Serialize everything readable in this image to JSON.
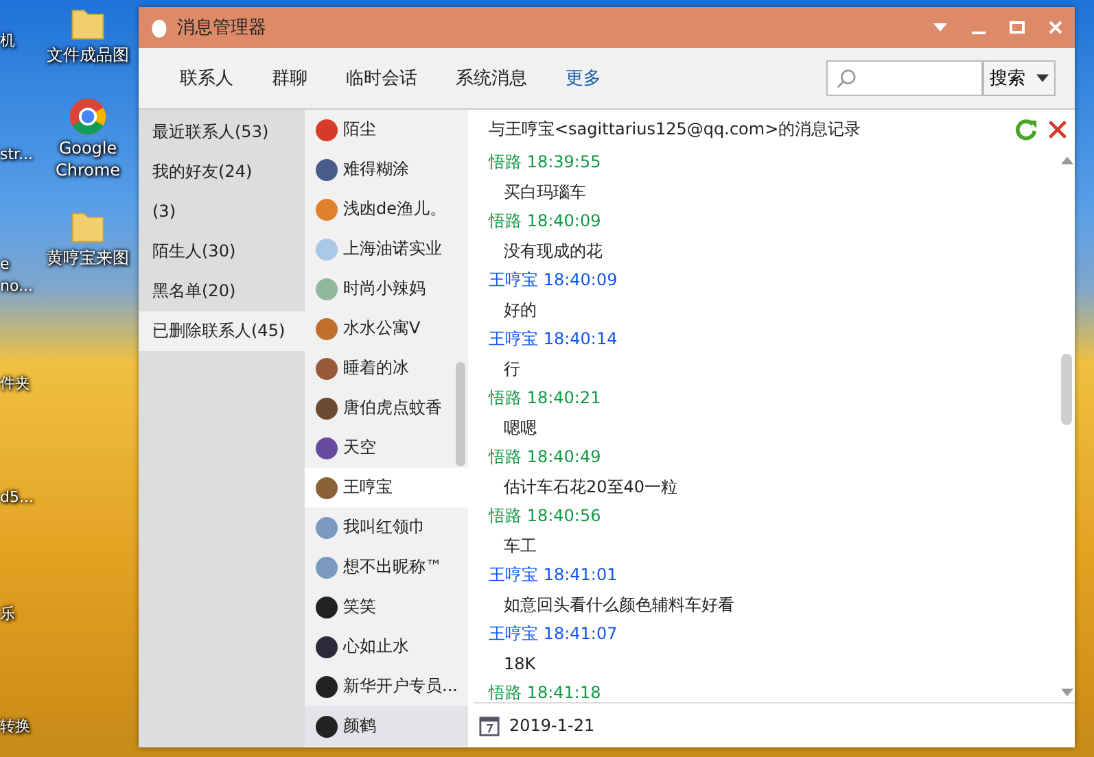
{
  "desktop": {
    "icons": [
      {
        "label": "机",
        "kind": "generic"
      },
      {
        "label": "str...",
        "kind": "generic"
      },
      {
        "label": "e\nno...",
        "kind": "generic"
      },
      {
        "label": "件夹",
        "kind": "generic"
      },
      {
        "label": "d5...",
        "kind": "generic"
      },
      {
        "label": "乐",
        "kind": "generic"
      },
      {
        "label": "转换",
        "kind": "generic"
      },
      {
        "label": "文件成品图",
        "kind": "folder"
      },
      {
        "label": "Google Chrome",
        "kind": "browser"
      },
      {
        "label": "黄哼宝来图",
        "kind": "folder"
      }
    ]
  },
  "window": {
    "title": "消息管理器"
  },
  "tabs": [
    {
      "label": "联系人",
      "kind": "tab"
    },
    {
      "label": "群聊",
      "kind": "tab"
    },
    {
      "label": "临时会话",
      "kind": "tab"
    },
    {
      "label": "系统消息",
      "kind": "tab"
    },
    {
      "label": "更多",
      "kind": "link"
    }
  ],
  "search": {
    "button": "搜索"
  },
  "sidebar": {
    "items": [
      {
        "label": "最近联系人(53)",
        "selected": false
      },
      {
        "label": "我的好友(24)",
        "selected": false
      },
      {
        "label": "(3)",
        "selected": false
      },
      {
        "label": "陌生人(30)",
        "selected": false
      },
      {
        "label": "黑名单(20)",
        "selected": false
      },
      {
        "label": "已删除联系人(45)",
        "selected": true
      }
    ]
  },
  "contacts": [
    {
      "name": "陌尘",
      "selected": false,
      "hovered": false,
      "color": "#d83a2a"
    },
    {
      "name": "难得糊涂",
      "selected": false,
      "hovered": false,
      "color": "#4a5c8a"
    },
    {
      "name": "浅凼de渔儿。",
      "selected": false,
      "hovered": false,
      "color": "#e0822c"
    },
    {
      "name": "上海油诺实业",
      "selected": false,
      "hovered": false,
      "color": "#a9c8e8"
    },
    {
      "name": "时尚小辣妈",
      "selected": false,
      "hovered": false,
      "color": "#8fb89a"
    },
    {
      "name": "水水公寓V",
      "selected": false,
      "hovered": false,
      "color": "#c0702a"
    },
    {
      "name": "睡着的冰",
      "selected": false,
      "hovered": false,
      "color": "#9a5a3a"
    },
    {
      "name": "唐伯虎点蚊香",
      "selected": false,
      "hovered": false,
      "color": "#6a4a30"
    },
    {
      "name": "天空",
      "selected": false,
      "hovered": false,
      "color": "#6a4aa0"
    },
    {
      "name": "王哼宝",
      "selected": true,
      "hovered": false,
      "color": "#8a6238"
    },
    {
      "name": "我叫红领巾",
      "selected": false,
      "hovered": false,
      "color": "#7a9ac0"
    },
    {
      "name": "想不出昵称™",
      "selected": false,
      "hovered": false,
      "color": "#7a9ac0"
    },
    {
      "name": "笑笑",
      "selected": false,
      "hovered": false,
      "color": "#222222"
    },
    {
      "name": "心如止水",
      "selected": false,
      "hovered": false,
      "color": "#2a2a3a"
    },
    {
      "name": "新华开户专员...",
      "selected": false,
      "hovered": false,
      "color": "#222222"
    },
    {
      "name": "颜鹤",
      "selected": false,
      "hovered": true,
      "color": "#222222"
    }
  ],
  "chat": {
    "title": "与王哼宝<sagittarius125@qq.com>的消息记录",
    "messages": [
      {
        "sender": "悟路",
        "time": "18:39:55",
        "text": "买白玛瑙车",
        "kind": "me"
      },
      {
        "sender": "悟路",
        "time": "18:40:09",
        "text": "没有现成的花",
        "kind": "me"
      },
      {
        "sender": "王哼宝",
        "time": "18:40:09",
        "text": "好的",
        "kind": "friend"
      },
      {
        "sender": "王哼宝",
        "time": "18:40:14",
        "text": "行",
        "kind": "friend"
      },
      {
        "sender": "悟路",
        "time": "18:40:21",
        "text": "嗯嗯",
        "kind": "me"
      },
      {
        "sender": "悟路",
        "time": "18:40:49",
        "text": "估计车石花20至40一粒",
        "kind": "me"
      },
      {
        "sender": "悟路",
        "time": "18:40:56",
        "text": "车工",
        "kind": "me"
      },
      {
        "sender": "王哼宝",
        "time": "18:41:01",
        "text": "如意回头看什么颜色辅料车好看",
        "kind": "friend"
      },
      {
        "sender": "王哼宝",
        "time": "18:41:07",
        "text": "18K",
        "kind": "friend"
      },
      {
        "sender": "悟路",
        "time": "18:41:18",
        "kind": "me"
      }
    ],
    "date": "2019-1-21"
  }
}
